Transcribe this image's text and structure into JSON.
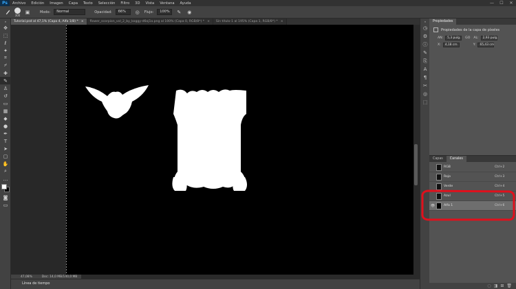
{
  "app": {
    "logo": "Ps"
  },
  "menu": [
    "Archivo",
    "Edición",
    "Imagen",
    "Capa",
    "Texto",
    "Selección",
    "Filtro",
    "3D",
    "Vista",
    "Ventana",
    "Ayuda"
  ],
  "window_controls": {
    "minimize": "—",
    "maximize": "☐",
    "close": "✕"
  },
  "options": {
    "brush_size": "300",
    "mode_label": "Modo:",
    "mode_value": "Normal",
    "opacity_label": "Opacidad:",
    "opacity_value": "66%",
    "flow_label": "Flujo:",
    "flow_value": "100%"
  },
  "tabs": [
    {
      "label": "Tutorial.psd al 47,1% (Capa 4, Alfa 1/8) *",
      "close": "×"
    },
    {
      "label": "flower_scorpion_vol_2_by_koggy-d6oj1o.png al 100% (Capa 0, RGB/8*) *",
      "close": "×"
    },
    {
      "label": "Sin título-1 al 195% (Capa 1, RGB/8*) *",
      "close": "×"
    }
  ],
  "status": {
    "zoom": "47,08%",
    "doc": "Doc: 14,0 MB/140,0 MB"
  },
  "timeline": {
    "label": "Línea de tiempo"
  },
  "properties": {
    "tab": "Propiedades",
    "title": "Propiedades de la capa de píxeles",
    "an_label": "AN:",
    "an_value": "5,3 pulg.",
    "go": "GO",
    "al_label": "AL:",
    "al_value": "2,93 pulg.",
    "x_label": "X:",
    "x_value": "4,18 cm",
    "y_label": "Y:",
    "y_value": "65,43 cm"
  },
  "channels_panel": {
    "tabs": [
      "Capas",
      "Canales"
    ],
    "rows": [
      {
        "name": "RGB",
        "shortcut": "Ctrl+2"
      },
      {
        "name": "Rojo",
        "shortcut": "Ctrl+3"
      },
      {
        "name": "Verde",
        "shortcut": "Ctrl+4"
      },
      {
        "name": "Azul",
        "shortcut": "Ctrl+5"
      },
      {
        "name": "Alfa 1",
        "shortcut": "Ctrl+6"
      }
    ]
  },
  "colors": {
    "canvas": "#000000",
    "highlight": "#e0101c",
    "ui_dark": "#323232",
    "ui_mid": "#535353"
  }
}
